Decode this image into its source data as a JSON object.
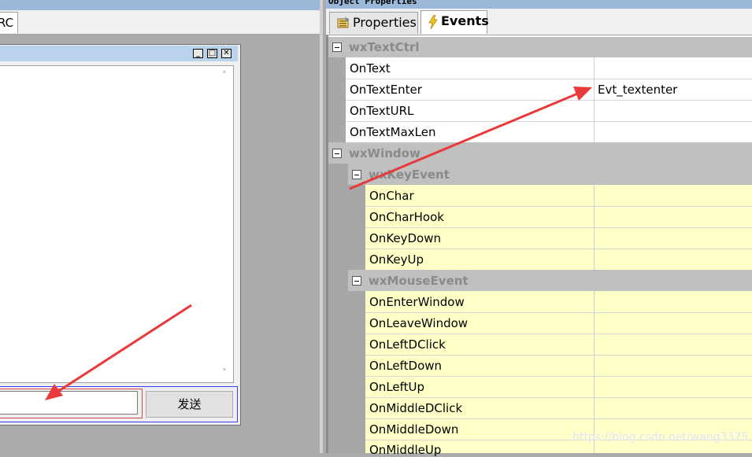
{
  "left_panel": {
    "tab_label": "RC",
    "window_buttons": {
      "minimize": "_",
      "maximize": "□",
      "close": "✕"
    },
    "scroll_up": "˄",
    "scroll_down": "˅",
    "send_button_label": "发送"
  },
  "props_panel": {
    "title": "Object Properties",
    "tabs": [
      {
        "label": "Properties",
        "icon": "properties-grid-icon",
        "active": false
      },
      {
        "label": "Events",
        "icon": "lightning-bolt-icon",
        "active": true
      }
    ],
    "categories": [
      {
        "name": "wxTextCtrl",
        "rows": [
          {
            "name": "OnText",
            "value": ""
          },
          {
            "name": "OnTextEnter",
            "value": "Evt_textenter"
          },
          {
            "name": "OnTextURL",
            "value": ""
          },
          {
            "name": "OnTextMaxLen",
            "value": ""
          }
        ]
      },
      {
        "name": "wxWindow",
        "subcategories": [
          {
            "name": "wxKeyEvent",
            "rows": [
              {
                "name": "OnChar",
                "value": ""
              },
              {
                "name": "OnCharHook",
                "value": ""
              },
              {
                "name": "OnKeyDown",
                "value": ""
              },
              {
                "name": "OnKeyUp",
                "value": ""
              }
            ]
          },
          {
            "name": "wxMouseEvent",
            "rows": [
              {
                "name": "OnEnterWindow",
                "value": ""
              },
              {
                "name": "OnLeaveWindow",
                "value": ""
              },
              {
                "name": "OnLeftDClick",
                "value": ""
              },
              {
                "name": "OnLeftDown",
                "value": ""
              },
              {
                "name": "OnLeftUp",
                "value": ""
              },
              {
                "name": "OnMiddleDClick",
                "value": ""
              },
              {
                "name": "OnMiddleDown",
                "value": ""
              },
              {
                "name": "OnMiddleUp",
                "value": ""
              }
            ]
          }
        ]
      }
    ]
  },
  "watermark": "https://blog.csdn.net/wang3375",
  "colors": {
    "annotation_arrow": "#e8393b",
    "category_header": "#c0c0c0",
    "event_row_highlight": "#ffffc8",
    "title_bar": "#9cb8d8"
  }
}
